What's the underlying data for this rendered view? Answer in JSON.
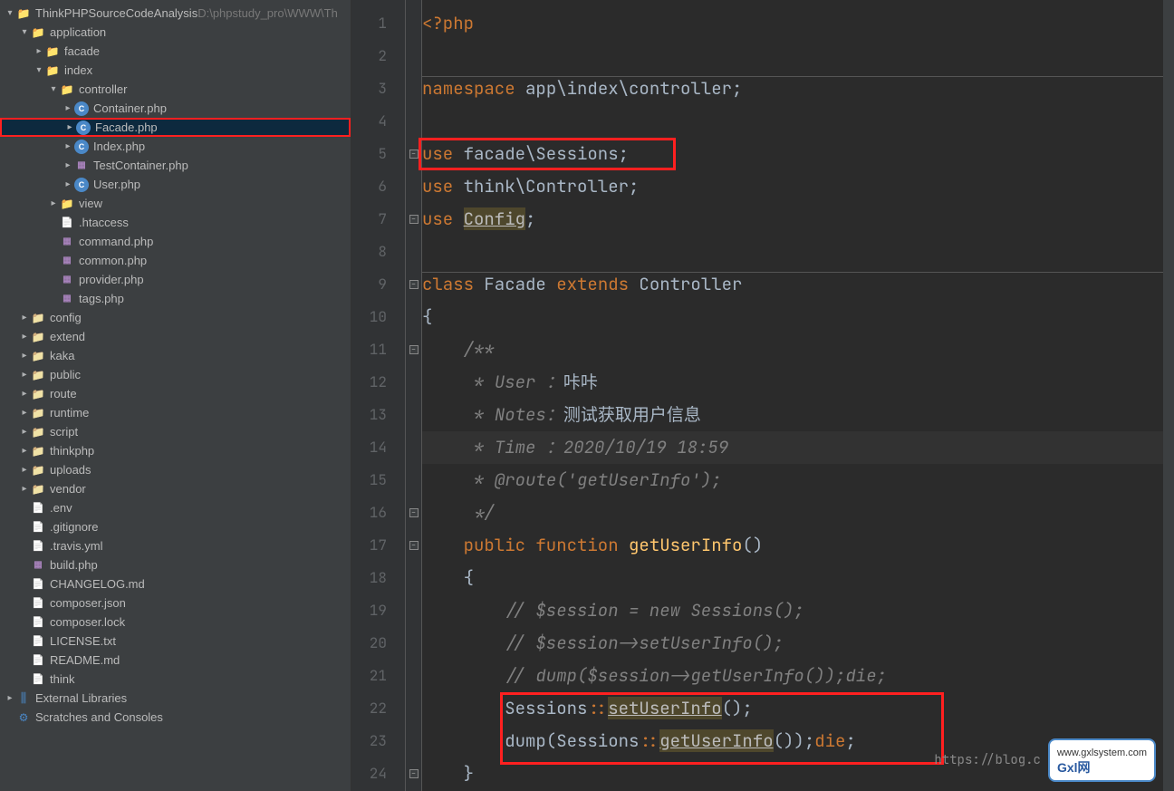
{
  "project": {
    "name": "ThinkPHPSourceCodeAnalysis",
    "path": "D:\\phpstudy_pro\\WWW\\Th"
  },
  "tree": [
    {
      "level": 0,
      "chev": "open",
      "icon": "folder-app",
      "label": "ThinkPHPSourceCodeAnalysis",
      "extra": "D:\\phpstudy_pro\\WWW\\Th"
    },
    {
      "level": 1,
      "chev": "open",
      "icon": "folder-app",
      "label": "application"
    },
    {
      "level": 2,
      "chev": "closed",
      "icon": "folder-app",
      "label": "facade"
    },
    {
      "level": 2,
      "chev": "open",
      "icon": "folder-app",
      "label": "index"
    },
    {
      "level": 3,
      "chev": "open",
      "icon": "folder-app",
      "label": "controller"
    },
    {
      "level": 4,
      "chev": "closed",
      "icon": "php-class",
      "label": "Container.php"
    },
    {
      "level": 4,
      "chev": "closed",
      "icon": "php-class",
      "label": "Facade.php",
      "selected": true,
      "highlighted": true
    },
    {
      "level": 4,
      "chev": "closed",
      "icon": "php-class",
      "label": "Index.php"
    },
    {
      "level": 4,
      "chev": "closed",
      "icon": "php-file",
      "label": "TestContainer.php"
    },
    {
      "level": 4,
      "chev": "closed",
      "icon": "php-class",
      "label": "User.php"
    },
    {
      "level": 3,
      "chev": "closed",
      "icon": "folder-app",
      "label": "view"
    },
    {
      "level": 3,
      "chev": "none",
      "icon": "generic-file",
      "label": ".htaccess"
    },
    {
      "level": 3,
      "chev": "none",
      "icon": "php-file",
      "label": "command.php"
    },
    {
      "level": 3,
      "chev": "none",
      "icon": "php-file",
      "label": "common.php"
    },
    {
      "level": 3,
      "chev": "none",
      "icon": "php-file",
      "label": "provider.php"
    },
    {
      "level": 3,
      "chev": "none",
      "icon": "php-file",
      "label": "tags.php"
    },
    {
      "level": 1,
      "chev": "closed",
      "icon": "folder-icon",
      "label": "config"
    },
    {
      "level": 1,
      "chev": "closed",
      "icon": "folder-icon",
      "label": "extend"
    },
    {
      "level": 1,
      "chev": "closed",
      "icon": "folder-icon",
      "label": "kaka"
    },
    {
      "level": 1,
      "chev": "closed",
      "icon": "folder-icon",
      "label": "public"
    },
    {
      "level": 1,
      "chev": "closed",
      "icon": "folder-icon",
      "label": "route"
    },
    {
      "level": 1,
      "chev": "closed",
      "icon": "folder-icon",
      "label": "runtime"
    },
    {
      "level": 1,
      "chev": "closed",
      "icon": "folder-icon",
      "label": "script"
    },
    {
      "level": 1,
      "chev": "closed",
      "icon": "folder-icon",
      "label": "thinkphp"
    },
    {
      "level": 1,
      "chev": "closed",
      "icon": "folder-icon",
      "label": "uploads"
    },
    {
      "level": 1,
      "chev": "closed",
      "icon": "folder-icon",
      "label": "vendor"
    },
    {
      "level": 1,
      "chev": "none",
      "icon": "generic-file",
      "label": ".env"
    },
    {
      "level": 1,
      "chev": "none",
      "icon": "generic-file",
      "label": ".gitignore"
    },
    {
      "level": 1,
      "chev": "none",
      "icon": "generic-file",
      "label": ".travis.yml"
    },
    {
      "level": 1,
      "chev": "none",
      "icon": "php-file",
      "label": "build.php"
    },
    {
      "level": 1,
      "chev": "none",
      "icon": "generic-file",
      "label": "CHANGELOG.md"
    },
    {
      "level": 1,
      "chev": "none",
      "icon": "generic-file",
      "label": "composer.json"
    },
    {
      "level": 1,
      "chev": "none",
      "icon": "generic-file",
      "label": "composer.lock"
    },
    {
      "level": 1,
      "chev": "none",
      "icon": "generic-file",
      "label": "LICENSE.txt"
    },
    {
      "level": 1,
      "chev": "none",
      "icon": "generic-file",
      "label": "README.md"
    },
    {
      "level": 1,
      "chev": "none",
      "icon": "generic-file",
      "label": "think"
    },
    {
      "level": 0,
      "chev": "closed",
      "icon": "lib-icon",
      "label": "External Libraries"
    },
    {
      "level": 0,
      "chev": "none",
      "icon": "scratch-icon",
      "label": "Scratches and Consoles"
    }
  ],
  "code": {
    "lines": [
      {
        "n": 1,
        "tokens": [
          [
            "kw",
            "<?php"
          ]
        ]
      },
      {
        "n": 2,
        "tokens": []
      },
      {
        "n": 3,
        "hr": true,
        "tokens": [
          [
            "kw",
            "namespace "
          ],
          [
            "ns",
            "app\\index\\controller"
          ],
          [
            "txt",
            ";"
          ]
        ]
      },
      {
        "n": 4,
        "tokens": []
      },
      {
        "n": 5,
        "fold": true,
        "tokens": [
          [
            "kw",
            "use "
          ],
          [
            "ns",
            "facade\\Sessions"
          ],
          [
            "txt",
            ";"
          ]
        ]
      },
      {
        "n": 6,
        "tokens": [
          [
            "kw",
            "use "
          ],
          [
            "ns",
            "think\\Controller"
          ],
          [
            "txt",
            ";"
          ]
        ]
      },
      {
        "n": 7,
        "fold": true,
        "tokens": [
          [
            "kw",
            "use "
          ],
          [
            "underline-y",
            "Config"
          ],
          [
            "txt",
            ";"
          ]
        ]
      },
      {
        "n": 8,
        "tokens": []
      },
      {
        "n": 9,
        "hr": true,
        "fold": true,
        "tokens": [
          [
            "kw",
            "class "
          ],
          [
            "cls",
            "Facade "
          ],
          [
            "kw",
            "extends "
          ],
          [
            "cls",
            "Controller"
          ]
        ]
      },
      {
        "n": 10,
        "tokens": [
          [
            "txt",
            "{"
          ]
        ]
      },
      {
        "n": 11,
        "fold": true,
        "tokens": [
          [
            "txt",
            "    "
          ],
          [
            "com",
            "/**"
          ]
        ]
      },
      {
        "n": 12,
        "tokens": [
          [
            "txt",
            "     "
          ],
          [
            "com",
            "* User ："
          ],
          [
            "chn",
            "咔咔"
          ]
        ]
      },
      {
        "n": 13,
        "tokens": [
          [
            "txt",
            "     "
          ],
          [
            "com",
            "* Notes："
          ],
          [
            "chn",
            "测试获取用户信息"
          ]
        ]
      },
      {
        "n": 14,
        "current": true,
        "tokens": [
          [
            "txt",
            "     "
          ],
          [
            "com",
            "* Time ：2020/10/19 18:59"
          ]
        ]
      },
      {
        "n": 15,
        "tokens": [
          [
            "txt",
            "     "
          ],
          [
            "com",
            "* @route('getUserInfo');"
          ]
        ]
      },
      {
        "n": 16,
        "fold": true,
        "tokens": [
          [
            "txt",
            "     "
          ],
          [
            "com",
            "*/"
          ]
        ]
      },
      {
        "n": 17,
        "fold": true,
        "tokens": [
          [
            "txt",
            "    "
          ],
          [
            "kw",
            "public function "
          ],
          [
            "func",
            "getUserInfo"
          ],
          [
            "txt",
            "()"
          ]
        ]
      },
      {
        "n": 18,
        "tokens": [
          [
            "txt",
            "    {"
          ]
        ]
      },
      {
        "n": 19,
        "tokens": [
          [
            "txt",
            "        "
          ],
          [
            "com",
            "// $session = new Sessions();"
          ]
        ]
      },
      {
        "n": 20,
        "tokens": [
          [
            "txt",
            "        "
          ],
          [
            "com",
            "// $session->setUserInfo();"
          ]
        ]
      },
      {
        "n": 21,
        "tokens": [
          [
            "txt",
            "        "
          ],
          [
            "com",
            "// dump($session->getUserInfo());die;"
          ]
        ]
      },
      {
        "n": 22,
        "tokens": [
          [
            "txt",
            "        "
          ],
          [
            "txt",
            "Sessions"
          ],
          [
            "kw",
            "::"
          ],
          [
            "underline-y",
            "setUserInfo"
          ],
          [
            "txt",
            "();"
          ]
        ]
      },
      {
        "n": 23,
        "tokens": [
          [
            "txt",
            "        "
          ],
          [
            "txt",
            "dump(Sessions"
          ],
          [
            "kw",
            "::"
          ],
          [
            "underline-y",
            "getUserInfo"
          ],
          [
            "txt",
            "());"
          ],
          [
            "kw",
            "die"
          ],
          [
            "txt",
            ";"
          ]
        ]
      },
      {
        "n": 24,
        "fold": true,
        "tokens": [
          [
            "txt",
            "    }"
          ]
        ]
      }
    ]
  },
  "watermark": {
    "url": "https://blog.c",
    "brand": "Gxl网",
    "sub": "www.gxlsystem.com"
  }
}
